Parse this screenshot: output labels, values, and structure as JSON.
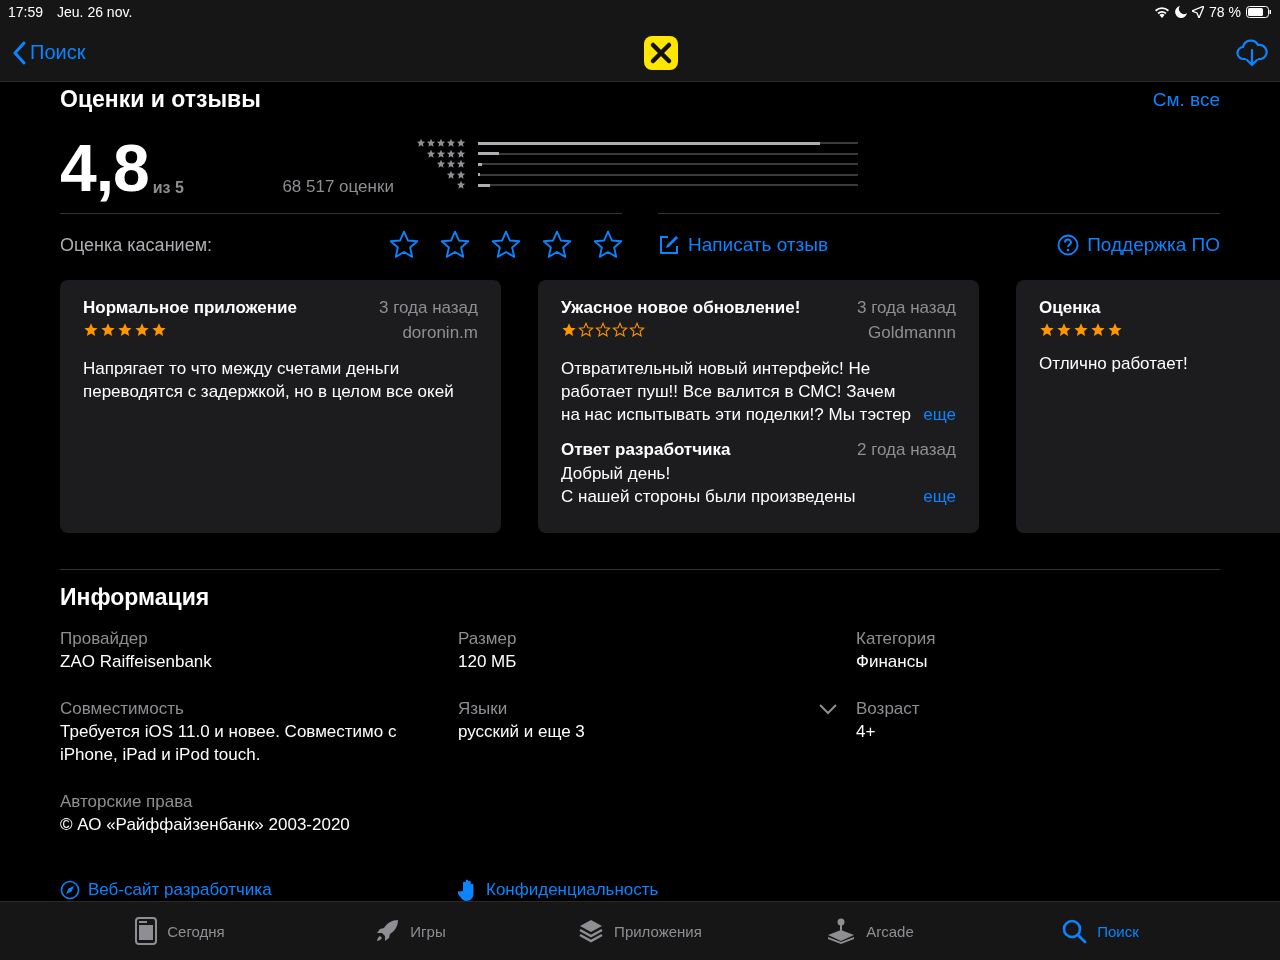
{
  "status_bar": {
    "time": "17:59",
    "date": "Jeu. 26 nov.",
    "battery": "78 %"
  },
  "nav": {
    "back": "Поиск"
  },
  "ratings": {
    "title": "Оценки и отзывы",
    "see_all": "См. все",
    "score": "4,8",
    "out_of": "из 5",
    "count": "68 517 оценки",
    "histogram": [
      {
        "level": 0.9
      },
      {
        "level": 0.055
      },
      {
        "level": 0.012
      },
      {
        "level": 0.005
      },
      {
        "level": 0.032
      }
    ],
    "tap_label": "Оценка касанием:",
    "tap_rating": {
      "stars": 0
    },
    "write_review": "Написать отзыв",
    "support": "Поддержка ПО"
  },
  "reviews": [
    {
      "title": "Нормальное приложение",
      "date": "3 года назад",
      "author": "doronin.m",
      "stars": 5,
      "body": "Напрягает то что между счетами деньги переводятся с задержкой, но в целом все окей"
    },
    {
      "title": "Ужасное новое обновление!",
      "date": "3 года назад",
      "author": "Goldmannn",
      "stars": 1,
      "body": "Отвратительный новый интерфейс! Не работает пуш!! Все валится в СМС! Зачем на нас испытывать эти поделки!? Мы тэстер",
      "more": "еще",
      "reply": {
        "title": "Ответ разработчика",
        "date": "2 года назад",
        "body": "Добрый день!\nС нашей стороны были произведены",
        "more": "еще"
      }
    },
    {
      "title": "Оценка",
      "stars": 5,
      "body": "Отлично работает!"
    }
  ],
  "info": {
    "title": "Информация",
    "items": [
      {
        "label": "Провайдер",
        "value": "ZAO Raiffeisenbank"
      },
      {
        "label": "Размер",
        "value": "120 МБ"
      },
      {
        "label": "Категория",
        "value": "Финансы"
      },
      {
        "label": "Совместимость",
        "value": "Требуется iOS 11.0 и новее. Совместимо с iPhone, iPad и iPod touch."
      },
      {
        "label": "Языки",
        "value": "русский и еще 3",
        "expanded": false
      },
      {
        "label": "Возраст",
        "value": "4+"
      },
      {
        "label": "Авторские права",
        "value": "© АО «Райффайзенбанк» 2003-2020"
      }
    ],
    "links": [
      {
        "kind": "website",
        "label": "Веб-сайт разработчика"
      },
      {
        "kind": "privacy",
        "label": "Конфиденциальность"
      }
    ]
  },
  "tab_bar": [
    {
      "kind": "today",
      "label": "Сегодня",
      "selected": false
    },
    {
      "kind": "games",
      "label": "Игры",
      "selected": false
    },
    {
      "kind": "apps",
      "label": "Приложения",
      "selected": false
    },
    {
      "kind": "arcade",
      "label": "Arcade",
      "selected": false
    },
    {
      "kind": "search",
      "label": "Поиск",
      "selected": true
    }
  ]
}
